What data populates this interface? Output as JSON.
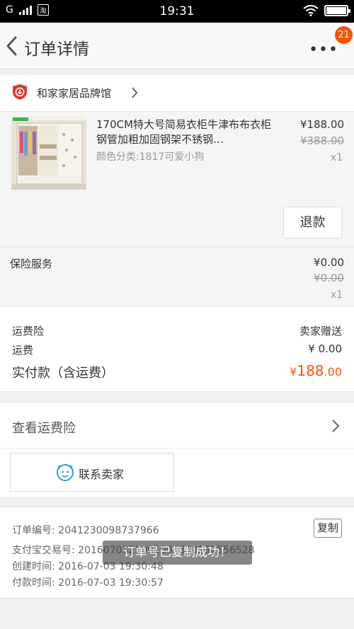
{
  "status_bar": {
    "network": "G",
    "carrier_label": "淘",
    "time": "19:31"
  },
  "header": {
    "title": "订单详情",
    "more_label": "•••",
    "badge_count": "21"
  },
  "shop": {
    "name": "和家家居品牌馆"
  },
  "item": {
    "title": "170CM特大号简易衣柜牛津布布衣柜钢管加粗加固钢架不锈钢…",
    "spec": "颜色分类:1817可爱小狗",
    "price": "¥188.00",
    "original_price": "¥388.00",
    "quantity": "x1",
    "refund_label": "退款"
  },
  "insurance": {
    "label": "保险服务",
    "price": "¥0.00",
    "original_price": "¥0.00",
    "quantity": "x1"
  },
  "fees": {
    "shipping_insurance_label": "运费险",
    "shipping_insurance_value": "卖家赠送",
    "shipping_label": "运费",
    "shipping_value": "¥ 0.00",
    "total_label": "实付款（含运费）",
    "total_currency": "¥",
    "total_integer": "188",
    "total_decimal": ".00"
  },
  "view_insurance_label": "查看运费险",
  "contact_seller_label": "联系卖家",
  "order_info": {
    "order_number": "订单编号: 2041230098737966",
    "alipay_number": "支付宝交易号: 2016070321001001810232556528",
    "created_time": "创建时间: 2016-07-03 19:30:48",
    "paid_time": "付款时间: 2016-07-03 19:30:57",
    "copy_label": "复制"
  },
  "toast": "订单号已复制成功！",
  "colors": {
    "accent": "#ff5000",
    "seller_icon": "#e03a2f",
    "contact_icon": "#2a9fd6"
  }
}
